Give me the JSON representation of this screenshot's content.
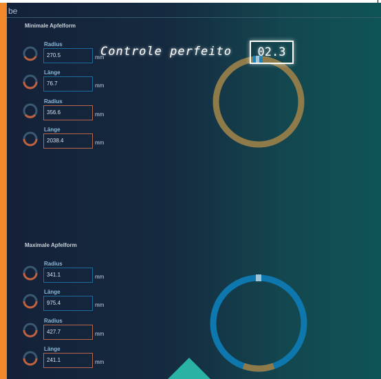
{
  "window": {
    "title": "be"
  },
  "overlay": {
    "label": "Controle perfeito",
    "value": "02.3"
  },
  "colors": {
    "accent": "#f28a2b",
    "ring_tan": "#8f7a4a",
    "ring_blue": "#0e77ad",
    "teal": "#2ab3a5"
  },
  "sections": [
    {
      "title": "Minimale Apfelform",
      "fields": [
        {
          "label": "Radius",
          "value": "270.5",
          "unit": "mm",
          "icon": "ring-gauge-icon"
        },
        {
          "label": "Länge",
          "value": "76.7",
          "unit": "mm",
          "icon": "ring-gauge-icon"
        },
        {
          "label": "Radius",
          "value": "356.6",
          "unit": "mm",
          "icon": "ring-gauge-icon"
        },
        {
          "label": "Länge",
          "value": "2038.4",
          "unit": "mm",
          "icon": "ring-gauge-icon"
        }
      ]
    },
    {
      "title": "Maximale Apfelform",
      "fields": [
        {
          "label": "Radius",
          "value": "341.1",
          "unit": "mm",
          "icon": "ring-gauge-icon"
        },
        {
          "label": "Länge",
          "value": "975.4",
          "unit": "mm",
          "icon": "ring-gauge-icon"
        },
        {
          "label": "Radius",
          "value": "427.7",
          "unit": "mm",
          "icon": "ring-gauge-icon"
        },
        {
          "label": "Länge",
          "value": "241.1",
          "unit": "mm",
          "icon": "ring-gauge-icon"
        }
      ]
    }
  ]
}
